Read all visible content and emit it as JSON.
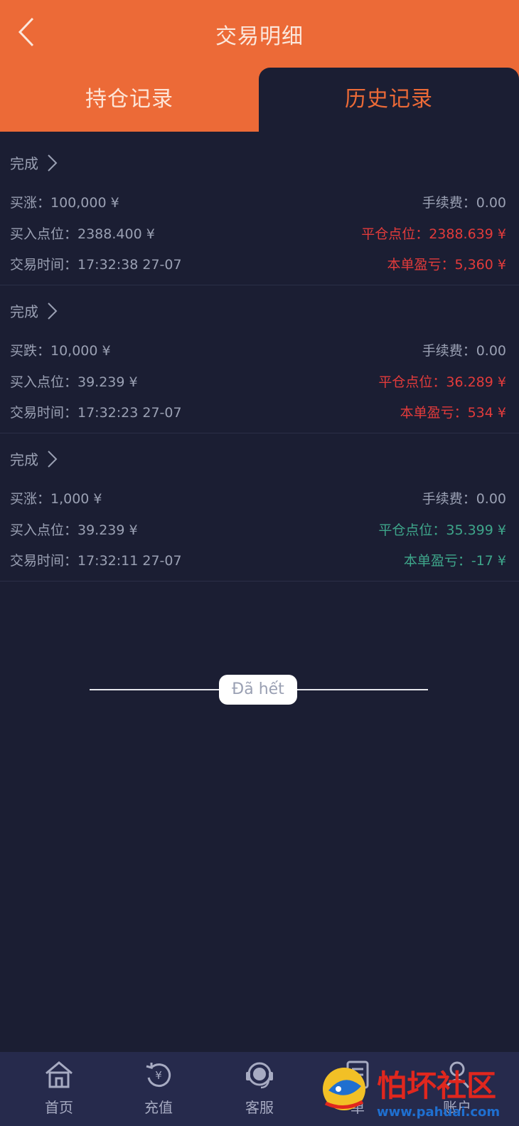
{
  "header": {
    "title": "交易明细",
    "tabs": [
      {
        "label": "持仓记录",
        "active": false
      },
      {
        "label": "历史记录",
        "active": true
      }
    ]
  },
  "records": [
    {
      "status": "完成",
      "direction": "买涨：100,000 ¥",
      "fee": "手续费：0.00",
      "entry": "买入点位：2388.400 ¥",
      "close": "平仓点位：2388.639 ¥",
      "time": "交易时间：17:32:38 27-07",
      "pnl": "本单盈亏：5,360 ¥",
      "result_color": "#e23b3b"
    },
    {
      "status": "完成",
      "direction": "买跌：10,000 ¥",
      "fee": "手续费：0.00",
      "entry": "买入点位：39.239 ¥",
      "close": "平仓点位：36.289 ¥",
      "time": "交易时间：17:32:23 27-07",
      "pnl": "本单盈亏：534 ¥",
      "result_color": "#e23b3b"
    },
    {
      "status": "完成",
      "direction": "买涨：1,000 ¥",
      "fee": "手续费：0.00",
      "entry": "买入点位：39.239 ¥",
      "close": "平仓点位：35.399 ¥",
      "time": "交易时间：17:32:11 27-07",
      "pnl": "本单盈亏：-17 ¥",
      "result_color": "#3ea58a"
    }
  ],
  "end_label": "Đã hết",
  "bottom_nav": [
    {
      "label": "首页",
      "icon": "home-icon"
    },
    {
      "label": "充值",
      "icon": "recharge-icon"
    },
    {
      "label": "客服",
      "icon": "customer-service-icon"
    },
    {
      "label": "单",
      "icon": "orders-icon"
    },
    {
      "label": "账户",
      "icon": "account-icon"
    }
  ],
  "watermark": {
    "text": "怕坏社区",
    "url": "www.pahuai.com"
  },
  "colors": {
    "accent": "#ec6a37",
    "background": "#1b1e33",
    "profit": "#e23b3b",
    "loss": "#3ea58a",
    "nav_bg": "#262a4c"
  }
}
